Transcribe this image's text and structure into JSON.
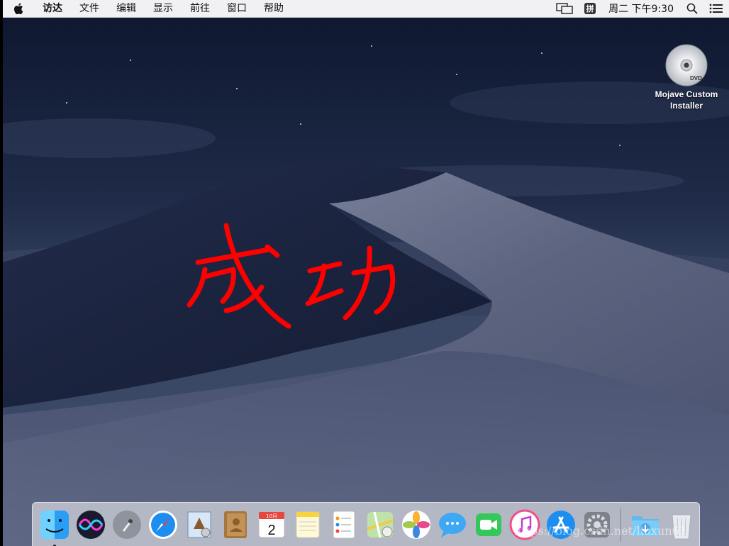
{
  "menubar": {
    "app_name": "访达",
    "items": [
      "文件",
      "编辑",
      "显示",
      "前往",
      "窗口",
      "帮助"
    ],
    "ime_label": "拼",
    "clock": "周二 下午9:30"
  },
  "desktop": {
    "icon_label_line1": "Mojave Custom",
    "icon_label_line2": "Installer",
    "disc_text": "DVD",
    "annotation_text": "成功",
    "annotation_color": "#ff0000"
  },
  "dock": {
    "items": [
      {
        "name": "finder-icon",
        "running": true
      },
      {
        "name": "siri-icon",
        "running": false
      },
      {
        "name": "launchpad-icon",
        "running": false
      },
      {
        "name": "safari-icon",
        "running": false
      },
      {
        "name": "mail-icon",
        "running": false
      },
      {
        "name": "contacts-icon",
        "running": false
      },
      {
        "name": "calendar-icon",
        "running": false
      },
      {
        "name": "notes-icon",
        "running": false
      },
      {
        "name": "reminders-icon",
        "running": false
      },
      {
        "name": "maps-icon",
        "running": false
      },
      {
        "name": "photos-icon",
        "running": false
      },
      {
        "name": "messages-icon",
        "running": false
      },
      {
        "name": "facetime-icon",
        "running": false
      },
      {
        "name": "itunes-icon",
        "running": false
      },
      {
        "name": "app-store-icon",
        "running": false
      },
      {
        "name": "system-preferences-icon",
        "running": false
      }
    ],
    "calendar_month": "10月",
    "calendar_day": "2",
    "watermark": "https://blog.csdn.net/liuxun61"
  },
  "colors": {
    "menubar_bg": "#f1f1f3",
    "accent_blue": "#1d8ef0",
    "annotation_red": "#ff0000"
  }
}
